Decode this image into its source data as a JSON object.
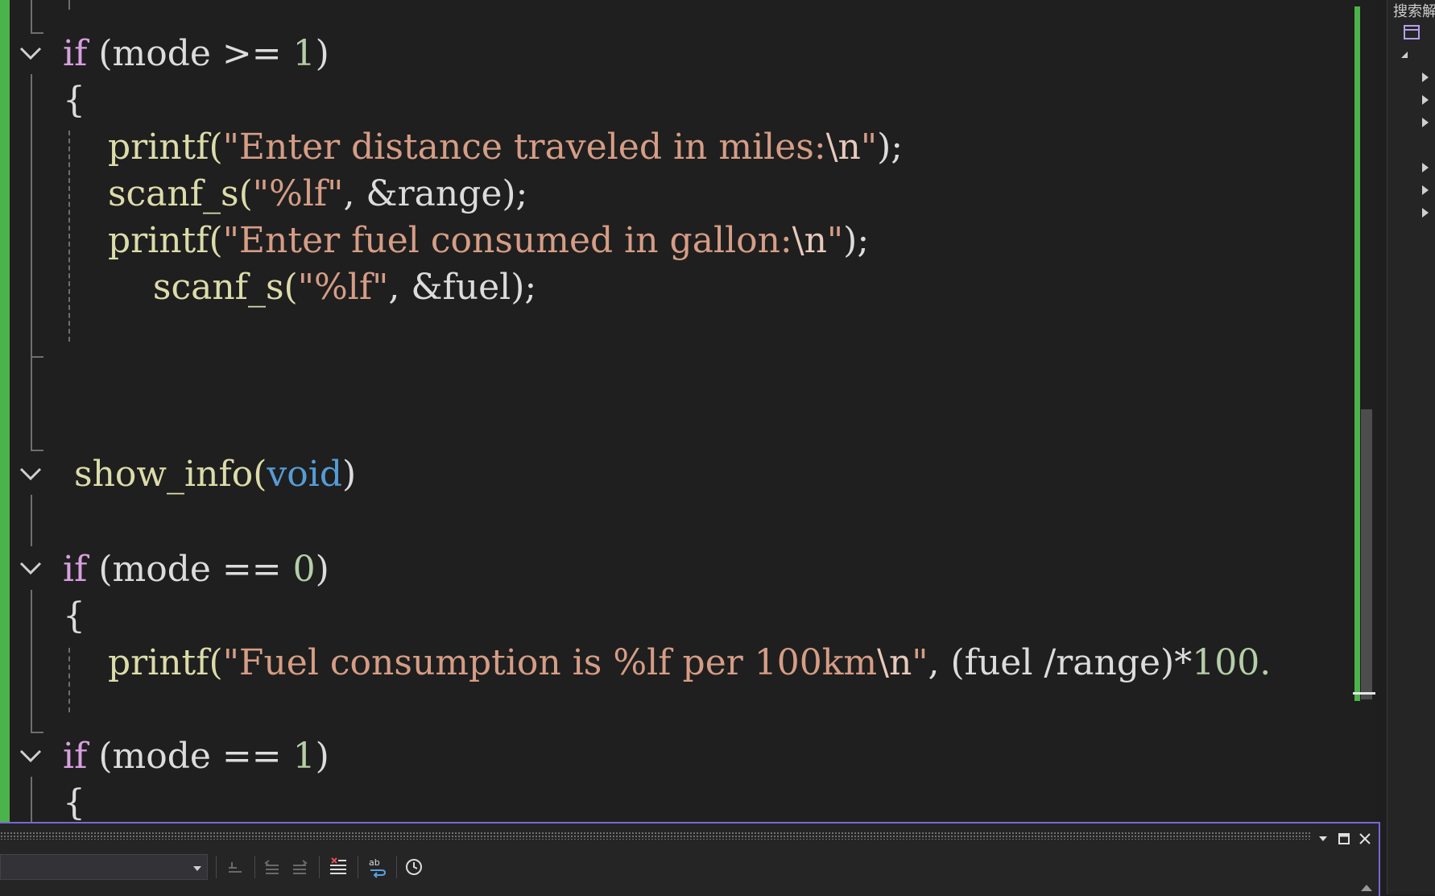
{
  "code_lines": [
    {
      "id": "if-mode-ge-1",
      "parts": [
        {
          "t": "if",
          "c": "kw"
        },
        {
          "t": " (mode >= "
        },
        {
          "t": "1",
          "c": "num"
        },
        {
          "t": ")"
        }
      ]
    },
    {
      "id": "brace-open-1",
      "parts": [
        {
          "t": "{"
        }
      ]
    },
    {
      "id": "printf-distance",
      "parts": [
        {
          "t": "    printf(",
          "c": "fn"
        },
        {
          "t": "\"Enter distance traveled in miles:",
          "c": "str"
        },
        {
          "t": "\\n",
          "c": "esc"
        },
        {
          "t": "\"",
          "c": "str"
        },
        {
          "t": ");"
        }
      ]
    },
    {
      "id": "scanf-range",
      "parts": [
        {
          "t": "    scanf_s(",
          "c": "fn"
        },
        {
          "t": "\"%lf\"",
          "c": "str"
        },
        {
          "t": ", &range);"
        }
      ]
    },
    {
      "id": "printf-fuel",
      "parts": [
        {
          "t": "    printf(",
          "c": "fn"
        },
        {
          "t": "\"Enter fuel consumed in gallon:",
          "c": "str"
        },
        {
          "t": "\\n",
          "c": "esc"
        },
        {
          "t": "\"",
          "c": "str"
        },
        {
          "t": ");"
        }
      ]
    },
    {
      "id": "scanf-fuel",
      "parts": [
        {
          "t": "        scanf_s(",
          "c": "fn"
        },
        {
          "t": "\"%lf\"",
          "c": "str"
        },
        {
          "t": ", &fuel);"
        }
      ]
    },
    {
      "id": "show-info",
      "parts": [
        {
          "t": " show_info(",
          "c": "fn"
        },
        {
          "t": "void",
          "c": "type"
        },
        {
          "t": ")"
        }
      ]
    },
    {
      "id": "if-mode-eq-0",
      "parts": [
        {
          "t": "if",
          "c": "kw"
        },
        {
          "t": " (mode == "
        },
        {
          "t": "0",
          "c": "num"
        },
        {
          "t": ")"
        }
      ]
    },
    {
      "id": "brace-open-2",
      "parts": [
        {
          "t": "{"
        }
      ]
    },
    {
      "id": "printf-consumption",
      "parts": [
        {
          "t": "    printf(",
          "c": "fn"
        },
        {
          "t": "\"Fuel consumption is %lf per 100km",
          "c": "str"
        },
        {
          "t": "\\n",
          "c": "esc"
        },
        {
          "t": "\"",
          "c": "str"
        },
        {
          "t": ", (fuel /range)*"
        },
        {
          "t": "100.",
          "c": "num"
        }
      ]
    },
    {
      "id": "if-mode-eq-1",
      "parts": [
        {
          "t": "if",
          "c": "kw"
        },
        {
          "t": " (mode == "
        },
        {
          "t": "1",
          "c": "num"
        },
        {
          "t": ")"
        }
      ]
    },
    {
      "id": "brace-open-3",
      "parts": [
        {
          "t": "{"
        }
      ]
    }
  ],
  "side_panel": {
    "title": "搜索解"
  },
  "bottom_panel": {
    "combo_value": ""
  },
  "icons": [
    "collapse-chevron-icon",
    "dropdown-arrow-icon",
    "maximize-icon",
    "close-icon",
    "clear-all-icon",
    "word-wrap-icon",
    "clock-icon",
    "expand-triangle-icon"
  ],
  "colors": {
    "keyword": "#d8a0df",
    "string": "#d69d85",
    "number": "#b5cea8",
    "type": "#569cd6",
    "change_bar": "#4cb34a",
    "panel_accent": "#7a67d8"
  }
}
